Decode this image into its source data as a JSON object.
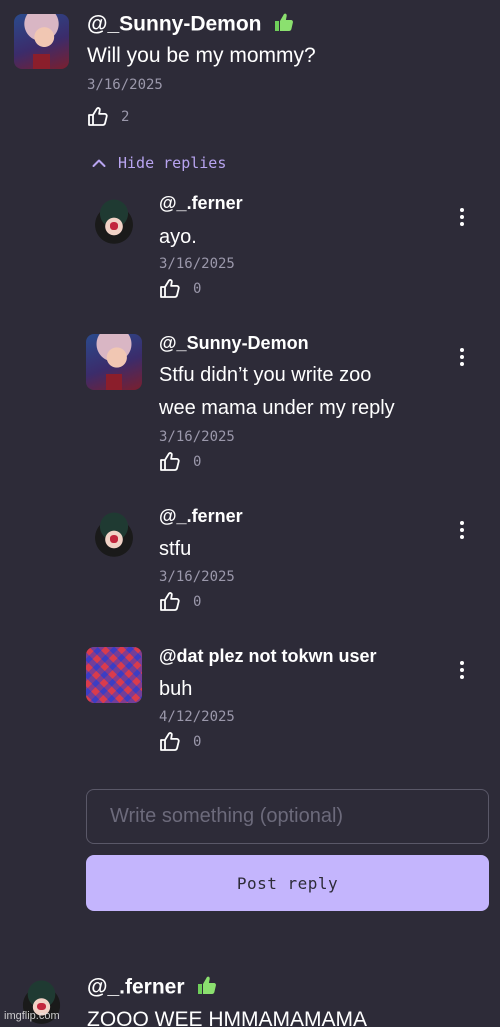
{
  "comments": [
    {
      "username": "@_Sunny-Demon",
      "text": "Will you be my mommy?",
      "date": "3/16/2025",
      "likes": "2",
      "badge_icon": "thumbs-up-emoji",
      "replies_toggle": "Hide replies"
    },
    {
      "username": "@_.ferner",
      "text": "ZOOO WEE HMMAMAMAMA",
      "badge_icon": "thumbs-up-emoji"
    }
  ],
  "replies": [
    {
      "username": "@_.ferner",
      "lines": [
        "ayo."
      ],
      "date": "3/16/2025",
      "likes": "0"
    },
    {
      "username": "@_Sunny-Demon",
      "lines": [
        "Stfu didn’t you write zoo",
        "wee mama under my reply"
      ],
      "date": "3/16/2025",
      "likes": "0"
    },
    {
      "username": "@_.ferner",
      "lines": [
        "stfu"
      ],
      "date": "3/16/2025",
      "likes": "0"
    },
    {
      "username": "@dat plez not tokwn user",
      "lines": [
        "buh"
      ],
      "date": "4/12/2025",
      "likes": "0"
    }
  ],
  "reply_form": {
    "placeholder": "Write something (optional)",
    "button_label": "Post reply"
  },
  "watermark": "imgflip.com",
  "colors": {
    "background": "#2d2b38",
    "accent": "#c4b5fd",
    "link": "#b8a4f0",
    "muted": "#9b98ab"
  }
}
